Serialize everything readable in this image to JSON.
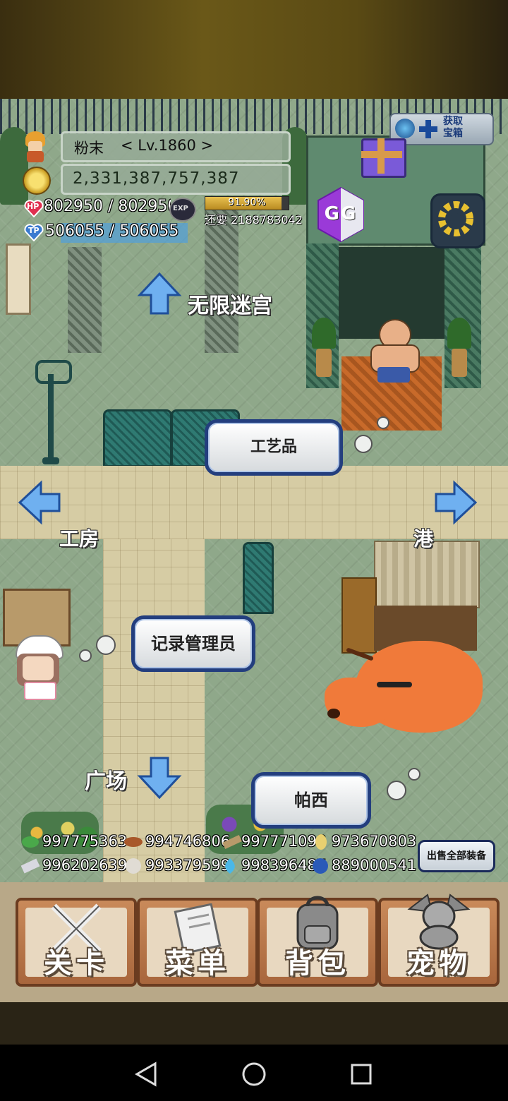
{
  "player": {
    "name": "粉末",
    "level": "< Lv.1860 >",
    "gold": "2,331,387,757,387",
    "hp": "802950 / 802950",
    "tp": "506055 / 506055",
    "exp_percent_text": "91.90%",
    "exp_progress": 0.919,
    "exp_remaining": "还要 2188783042",
    "exp_badge": "EXP",
    "hp_badge": "HP",
    "tp_badge": "TP"
  },
  "top_right": {
    "reward_label": "获取\n宝箱",
    "gg_label": "GG"
  },
  "map_labels": {
    "up": "无限迷宫",
    "left": "工房",
    "right": "港",
    "down": "广场"
  },
  "npc_buttons": {
    "crafts": "工艺品",
    "record_keeper": "记录管理员",
    "percy": "帕西"
  },
  "resources": [
    {
      "icon": "herb-icon",
      "value": "997775363"
    },
    {
      "icon": "meat-icon",
      "value": "994746806"
    },
    {
      "icon": "wood-icon",
      "value": "997771098"
    },
    {
      "icon": "seed-icon",
      "value": "973670803"
    },
    {
      "icon": "ingot-icon",
      "value": "996202639"
    },
    {
      "icon": "stone-icon",
      "value": "993379599"
    },
    {
      "icon": "flame-icon",
      "value": "998396487"
    },
    {
      "icon": "orb-icon",
      "value": "889000541"
    }
  ],
  "sell_all_label": "出售全部装备",
  "menu": [
    {
      "label": "关卡",
      "icon": "crossed-swords-icon"
    },
    {
      "label": "菜单",
      "icon": "book-icon"
    },
    {
      "label": "背包",
      "icon": "backpack-icon"
    },
    {
      "label": "宠物",
      "icon": "dragon-icon"
    }
  ],
  "colors": {
    "hp_heart": "#e03050",
    "tp_heart": "#3a7ad0",
    "button_border": "#233e7e"
  }
}
